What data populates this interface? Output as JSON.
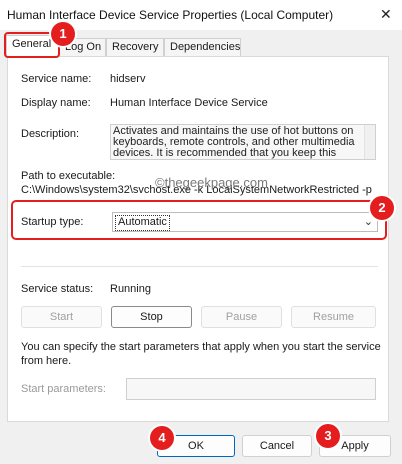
{
  "window": {
    "title": "Human Interface Device Service Properties (Local Computer)",
    "close_glyph": "✕"
  },
  "tabs": [
    {
      "label": "General",
      "active": true
    },
    {
      "label": "Log On",
      "active": false
    },
    {
      "label": "Recovery",
      "active": false
    },
    {
      "label": "Dependencies",
      "active": false
    }
  ],
  "general": {
    "service_name_label": "Service name:",
    "service_name_value": "hidserv",
    "display_name_label": "Display name:",
    "display_name_value": "Human Interface Device Service",
    "description_label": "Description:",
    "description_lines": [
      "Activates and maintains the use of hot buttons on",
      "keyboards, remote controls, and other multimedia",
      "devices. It is recommended that you keep this"
    ],
    "path_label": "Path to executable:",
    "path_value": "C:\\Windows\\system32\\svchost.exe -k LocalSystemNetworkRestricted -p",
    "startup_type_label": "Startup type:",
    "startup_type_value": "Automatic",
    "service_status_label": "Service status:",
    "service_status_value": "Running",
    "buttons": {
      "start": "Start",
      "stop": "Stop",
      "pause": "Pause",
      "resume": "Resume"
    },
    "help_text_lines": [
      "You can specify the start parameters that apply when you start the service",
      "from here."
    ],
    "start_params_label": "Start parameters:",
    "start_params_value": ""
  },
  "dialog_buttons": {
    "ok": "OK",
    "cancel": "Cancel",
    "apply": "Apply"
  },
  "annotations": {
    "step1": "1",
    "step2": "2",
    "step3": "3",
    "step4": "4",
    "accent_color": "#e41e1e"
  },
  "watermark": {
    "text": "©thegeekpage.com"
  }
}
